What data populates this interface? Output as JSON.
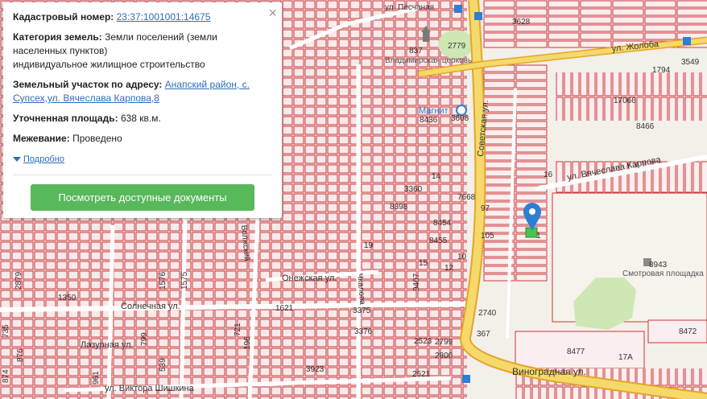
{
  "popup": {
    "close_glyph": "×",
    "cadastral_label": "Кадастровый номер:",
    "cadastral_value": "23:37:1001001:14675",
    "category_label": "Категория земель:",
    "category_value_1": "Земли поселений (земли населенных пунктов)",
    "category_value_2": "индивидуальное жилищное строительство",
    "address_label": "Земельный участок по адресу:",
    "address_value": "Анапский район, с. Супсех,ул. Вячеслава Карпова,8",
    "area_label": "Уточненная площадь:",
    "area_value": "638 кв.м.",
    "survey_label": "Межевание:",
    "survey_value": "Проведено",
    "more_label": "Подробно",
    "docs_button": "Посмотреть доступные документы"
  },
  "map": {
    "streets": {
      "zhuloba": "ул. Жолоба",
      "sovetskaya": "Советская ул.",
      "karpova": "ул. Вячеслава Карпова",
      "vinogradnaya": "Виноградная ул.",
      "solnechnaya": "Солнечная ул.",
      "onezhskaya": "Онежская ул.",
      "shishkina": "ул. Виктора Шишкина",
      "lazurnaya": "Лазурная ул.",
      "peschanaya": "ул. Песчаная",
      "chkalova": "Чкалова",
      "volzhskaya": "Волжский"
    },
    "pois": {
      "church": "Владимирская церковь",
      "magnit": "Магнит",
      "stadium": "Смотровая площадка"
    },
    "parcel_numbers": [
      "2779",
      "837",
      "8436",
      "3608",
      "3628",
      "17066",
      "8466",
      "3549",
      "1794",
      "1",
      "3360",
      "8398",
      "7668",
      "8454",
      "8455",
      "97",
      "105",
      "8943",
      "3376",
      "3375",
      "2740",
      "367",
      "1621",
      "8472",
      "8477",
      "17А",
      "2523",
      "2799",
      "2800",
      "2521",
      "3923",
      "1576",
      "1575",
      "1350",
      "2879",
      "735",
      "721",
      "799",
      "196",
      "961",
      "876",
      "874",
      "539",
      "16",
      "14",
      "9407",
      "19",
      "10",
      "12",
      "15"
    ]
  },
  "colors": {
    "parcel_line": "#c9373a",
    "parcel_fill": "#f7e1e1",
    "road_fill": "#f5d96b",
    "road_edge": "#e7a32a",
    "green": "#cfe7b4",
    "button": "#57b85c",
    "pin": "#2d7fd3",
    "selected_parcel": "#49c44c"
  }
}
